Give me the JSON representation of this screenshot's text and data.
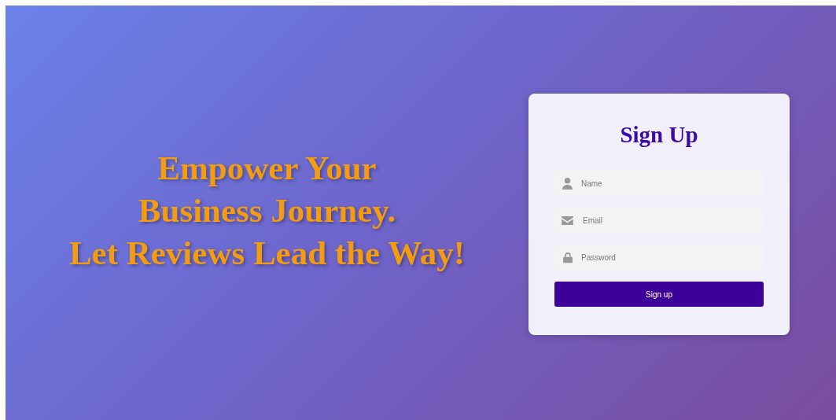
{
  "headline": {
    "lines": [
      "Empower Your",
      "Business Journey.",
      "Let Reviews Lead the Way!"
    ]
  },
  "form": {
    "title": "Sign Up",
    "fields": [
      {
        "kind": "name",
        "placeholder": "Name"
      },
      {
        "kind": "email",
        "placeholder": "Email"
      },
      {
        "kind": "password",
        "placeholder": "Password"
      }
    ],
    "submit": "Sign up"
  }
}
